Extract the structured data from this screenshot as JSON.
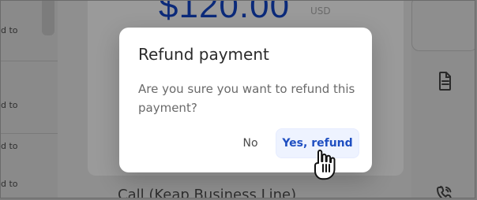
{
  "background": {
    "left_items": [
      {
        "text": "d to"
      },
      {
        "text": "d to"
      },
      {
        "text": "d to"
      },
      {
        "text": "d to"
      }
    ],
    "amount": "$120.00",
    "currency": "USD",
    "bottom_row_title": "Call (Keap Business Line)",
    "icons": {
      "doc": "document-icon",
      "phone": "phone-icon"
    }
  },
  "modal": {
    "title": "Refund payment",
    "message": "Are you sure you want to refund this payment?",
    "buttons": {
      "cancel_label": "No",
      "confirm_label": "Yes, refund"
    }
  },
  "colors": {
    "primary": "#1f4fc1",
    "primary_soft_bg": "#eef3ff",
    "overlay": "#8f8f8f"
  }
}
